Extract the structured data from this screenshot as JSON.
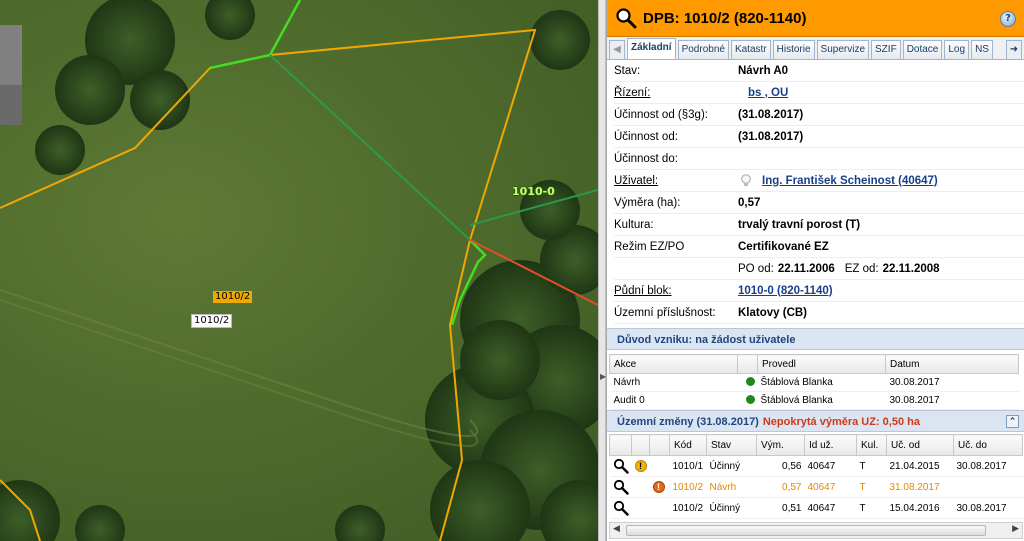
{
  "map": {
    "parcel_label_orange": "1010/2",
    "parcel_label_white": "1010/2",
    "block_label": "1010-0"
  },
  "panel": {
    "title": "DPB: 1010/2 (820-1140)",
    "header_color": "#ff9900",
    "tabs": [
      "Základní",
      "Podrobné",
      "Katastr",
      "Historie",
      "Supervize",
      "SZIF",
      "Dotace",
      "Log",
      "NS"
    ],
    "active_tab": "Základní"
  },
  "details": {
    "stav_label": "Stav:",
    "stav_value": "Návrh A0",
    "rizeni_label": "Řízení:",
    "rizeni_value": "bs  , OU",
    "ucinnost_3g_label": "Účinnost od (§3g):",
    "ucinnost_3g_value": "(31.08.2017)",
    "ucinnost_od_label": "Účinnost od:",
    "ucinnost_od_value": "(31.08.2017)",
    "ucinnost_do_label": "Účinnost do:",
    "ucinnost_do_value": "",
    "uzivatel_label": "Uživatel:",
    "uzivatel_value": "Ing. František Scheinost (40647)",
    "vymera_label": "Výměra (ha):",
    "vymera_value": "0,57",
    "kultura_label": "Kultura:",
    "kultura_value": "trvalý travní porost (T)",
    "rezim_label": "Režim EZ/PO",
    "rezim_value": "Certifikované EZ",
    "po_od_label": "PO od:",
    "po_od_value": "22.11.2006",
    "ez_od_label": "EZ od:",
    "ez_od_value": "22.11.2008",
    "pudni_blok_label": "Půdní blok:",
    "pudni_blok_value": "1010-0 (820-1140)",
    "uzemni_prislusnost_label": "Územní příslušnost:",
    "uzemni_prislusnost_value": "Klatovy (CB)"
  },
  "duvod": {
    "title": "Důvod vzniku: na žádost uživatele"
  },
  "akce_table": {
    "headers": [
      "Akce",
      "",
      "Provedl",
      "Datum"
    ],
    "rows": [
      {
        "akce": "Návrh",
        "provedl": "Štáblová Blanka",
        "datum": "30.08.2017"
      },
      {
        "akce": "Audit 0",
        "provedl": "Štáblová Blanka",
        "datum": "30.08.2017"
      }
    ]
  },
  "zmeny": {
    "title": "Územní změny (31.08.2017)",
    "warning": "Nepokrytá výměra UZ: 0,50 ha",
    "headers": [
      "",
      "",
      "",
      "Kód",
      "Stav",
      "Vým.",
      "Id už.",
      "Kul.",
      "Uč. od",
      "Uč. do"
    ],
    "rows": [
      {
        "kod": "1010/1",
        "stav": "Účinný",
        "vym": "0,56",
        "id": "40647",
        "kul": "T",
        "uc_od": "21.04.2015",
        "uc_do": "30.08.2017"
      },
      {
        "kod": "1010/2",
        "stav": "Návrh",
        "vym": "0,57",
        "id": "40647",
        "kul": "T",
        "uc_od": "31.08.2017",
        "uc_do": ""
      },
      {
        "kod": "1010/2",
        "stav": "Účinný",
        "vym": "0,51",
        "id": "40647",
        "kul": "T",
        "uc_od": "15.04.2016",
        "uc_do": "30.08.2017"
      }
    ]
  }
}
